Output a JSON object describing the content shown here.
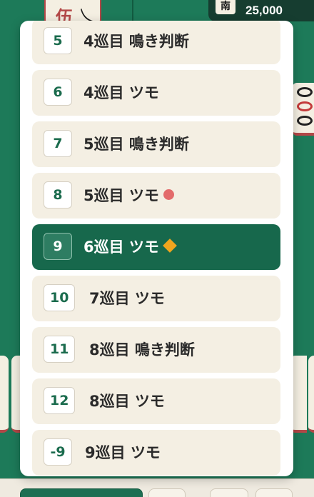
{
  "background": {
    "score": "25,000",
    "wind": "南"
  },
  "turn_list": {
    "items": [
      {
        "number": "5",
        "label": "4巡目 鳴き判断",
        "marker": "none",
        "selected": false
      },
      {
        "number": "6",
        "label": "4巡目 ツモ",
        "marker": "none",
        "selected": false
      },
      {
        "number": "7",
        "label": "5巡目 鳴き判断",
        "marker": "none",
        "selected": false
      },
      {
        "number": "8",
        "label": "5巡目 ツモ",
        "marker": "red-dot",
        "selected": false
      },
      {
        "number": "9",
        "label": "6巡目 ツモ",
        "marker": "diamond",
        "selected": true
      },
      {
        "number": "10",
        "label": "7巡目 ツモ",
        "marker": "none",
        "selected": false
      },
      {
        "number": "11",
        "label": "8巡目 鳴き判断",
        "marker": "none",
        "selected": false
      },
      {
        "number": "12",
        "label": "8巡目 ツモ",
        "marker": "none",
        "selected": false
      },
      {
        "number": "-9",
        "label": "9巡目 ツモ",
        "marker": "none",
        "selected": false
      }
    ]
  },
  "colors": {
    "table_green": "#1d7a59",
    "selected_bg": "#17684c",
    "item_bg": "#f4efe3",
    "number_green": "#1a6b4d",
    "red_dot": "#e36b6b",
    "diamond": "#f0a51e"
  }
}
